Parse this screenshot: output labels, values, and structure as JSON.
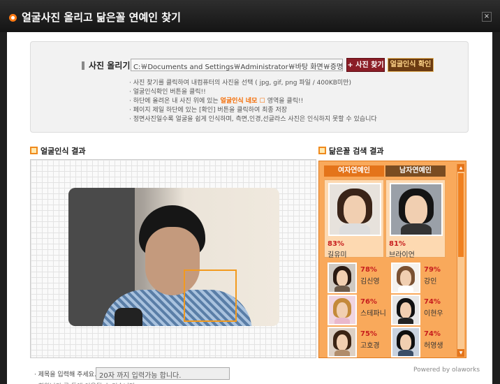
{
  "window": {
    "title": "얼굴사진 올리고 닮은꼴 연예인 찾기",
    "close": "×"
  },
  "upload": {
    "label": "사진 올리기",
    "path_value": "C:￦Documents and Settings￦Administrator￦바탕 화면￦증명사진.jpg",
    "find_button": "+ 사진 찾기",
    "confirm_button": "얼굴인식 확인",
    "instructions": [
      "· 사진 찾기를 클릭하여 내컴퓨터의 사진을 선택 ( jpg, gif, png 파일 / 400KB미만)",
      "· 얼굴인식확인 버튼을 클릭!!",
      "· 하단에 올려온 내 사진 위에 있는",
      "얼굴인식 네모",
      "영역을 클릭!!",
      "· 페이지 제일 하단에 있는 [확인] 버튼을 클릭하여 최종 저장",
      "· 정면사진일수록 얼굴을 쉽게 인식하며, 측면,인경,선글라스 사진은 인식하지 못할 수 있습니다"
    ]
  },
  "face_section": {
    "title": "얼굴인식 결과"
  },
  "match_section": {
    "title": "닮은꼴 검색 결과",
    "tab_female": "여자연예인",
    "tab_male": "남자연예인",
    "top_female": {
      "percent": "83%",
      "name": "길유미"
    },
    "top_male": {
      "percent": "81%",
      "name": "브라이언"
    },
    "ranked": [
      {
        "percent": "78%",
        "name": "김신영"
      },
      {
        "percent": "79%",
        "name": "강인"
      },
      {
        "percent": "76%",
        "name": "스테파니"
      },
      {
        "percent": "74%",
        "name": "이현우"
      },
      {
        "percent": "75%",
        "name": "고호경"
      },
      {
        "percent": "74%",
        "name": "허영생"
      }
    ],
    "scroll_up": "▲",
    "scroll_down": "▼"
  },
  "footer": {
    "powered_by": "Powered by olaworks",
    "comment_label": "· 제목을 입력해 주세요.",
    "comment_placeholder": "20자 까지 입력가능 합니다.",
    "cut_text": "· 회원님의 글 등에 이용될 수 있습니다."
  },
  "colors": {
    "accent": "#f29a1e",
    "title_bar": "#1e1e1e",
    "match_bg": "#f9a95b",
    "percent": "#c71d1d"
  }
}
